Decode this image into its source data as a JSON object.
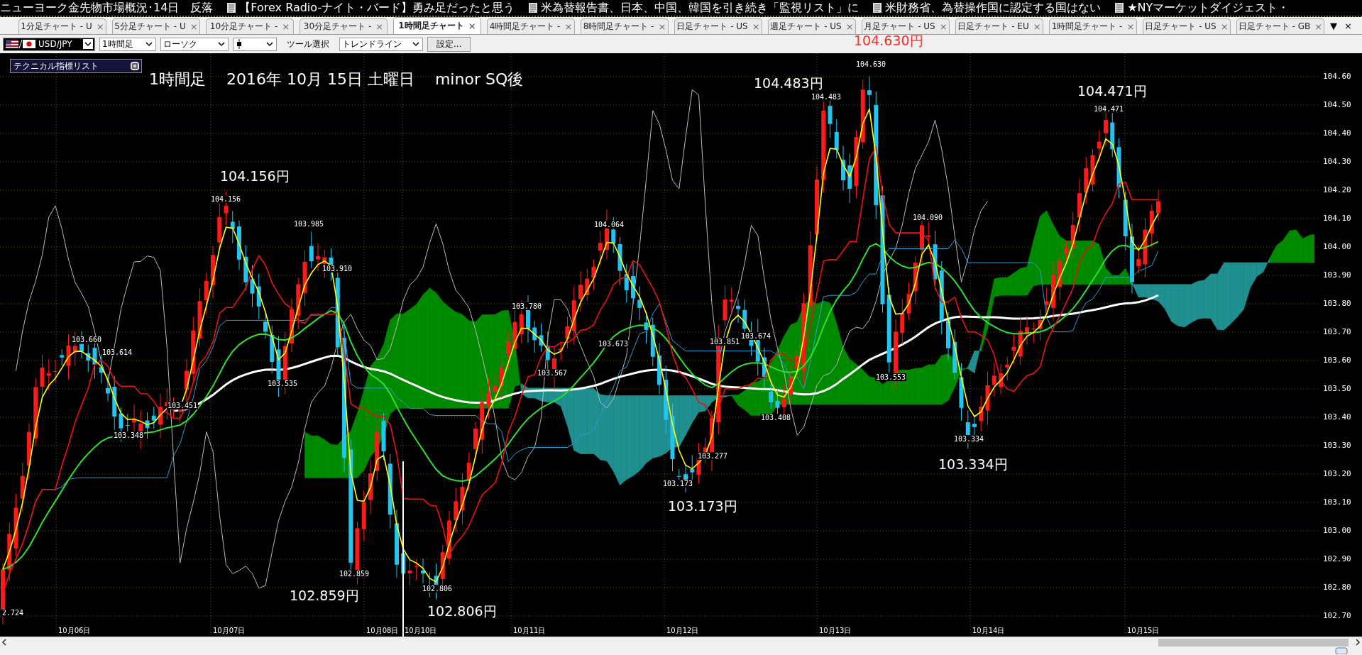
{
  "news_ticker": [
    {
      "text": "ニューヨーク金先物市場概況･14日　反落",
      "has_icon": false
    },
    {
      "text": "【Forex Radio-ナイト・バード】勇み足だったと思う",
      "has_icon": true
    },
    {
      "text": "米為替報告書、日本、中国、韓国を引き続き「監視リスト」に",
      "has_icon": true
    },
    {
      "text": "米財務省、為替操作国に認定する国はない",
      "has_icon": true
    },
    {
      "text": "★NYマーケットダイジェスト・",
      "has_icon": true
    }
  ],
  "tabs": [
    {
      "label": "1分足チャート - U",
      "close": "×",
      "selected": false
    },
    {
      "label": "5分足チャート - U",
      "close": "×",
      "selected": false
    },
    {
      "label": "10分足チャート -",
      "close": "×",
      "selected": false
    },
    {
      "label": "30分足チャート -",
      "close": "×",
      "selected": false
    },
    {
      "label": "1時間足チャート",
      "close": "×",
      "selected": true
    },
    {
      "label": "4時間足チャート -",
      "close": "×",
      "selected": false
    },
    {
      "label": "8時間足チャート -",
      "close": "×",
      "selected": false
    },
    {
      "label": "日足チャート - US",
      "close": "×",
      "selected": false
    },
    {
      "label": "週足チャート - US",
      "close": "×",
      "selected": false
    },
    {
      "label": "月足チャート - US",
      "close": "×",
      "selected": false
    },
    {
      "label": "日足チャート - EU",
      "close": "×",
      "selected": false
    },
    {
      "label": "1時間足チャート -",
      "close": "×",
      "selected": false
    },
    {
      "label": "日足チャート - US",
      "close": "×",
      "selected": false
    },
    {
      "label": "日足チャート - GB",
      "close": "×",
      "selected": false
    }
  ],
  "tab_bar_controls": [
    "▼",
    "×"
  ],
  "toolbar": {
    "pair": "USD/JPY",
    "timeframe": "1時間足",
    "chart_type": "ローソク",
    "tool_label": "ツール選択",
    "tool": "トレンドライン",
    "settings_button": "設定..."
  },
  "high_callout": "104.630円",
  "chart": {
    "indicator_list": "テクニカル指標リスト",
    "title": "1時間足　 2016年 10月 15日 土曜日　 minor SQ後",
    "callouts": [
      "104.156円",
      "104.483円",
      "104.471円",
      "102.859円",
      "102.806円",
      "103.173円",
      "103.334円"
    ],
    "point_labels": [
      "104.156",
      "103.985",
      "103.910",
      "103.660",
      "103.614",
      "103.535",
      "103.451",
      "103.348",
      "102.859",
      "102.806",
      "2.724",
      "104.064",
      "103.780",
      "103.673",
      "103.567",
      "103.851",
      "103.674",
      "103.408",
      "103.277",
      "103.173",
      "104.483",
      "104.630",
      "104.090",
      "103.553",
      "103.334",
      "104.471"
    ],
    "y_axis": [
      "104.60",
      "104.50",
      "104.40",
      "104.30",
      "104.20",
      "104.10",
      "104.00",
      "103.90",
      "103.80",
      "103.70",
      "103.60",
      "103.50",
      "103.40",
      "103.30",
      "103.20",
      "103.10",
      "103.00",
      "102.90",
      "102.80",
      "102.70"
    ],
    "x_axis": [
      "10月06日",
      "10月07日",
      "10月08日",
      "10月10日",
      "10月11日",
      "10月12日",
      "10月13日",
      "10月14日",
      "10月15日"
    ]
  }
}
